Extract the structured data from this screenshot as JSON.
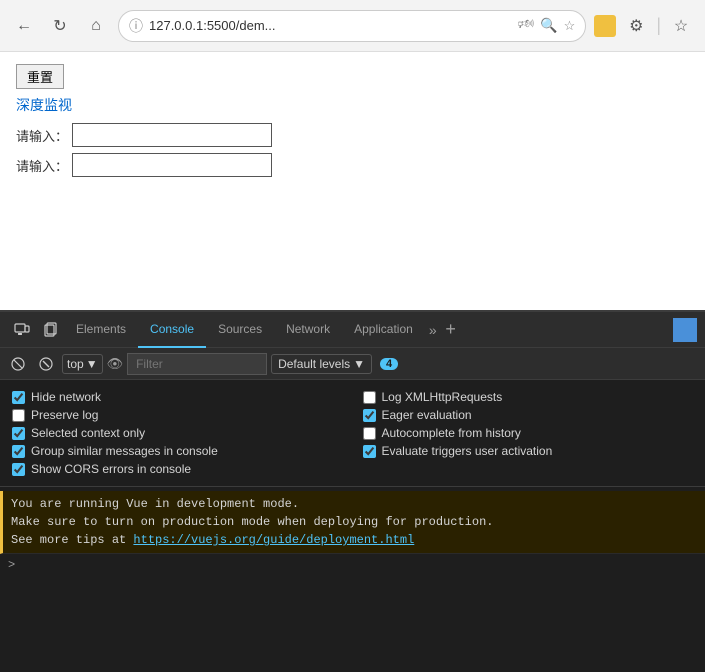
{
  "browser": {
    "url": "127.0.0.1:5500/dem...",
    "back_btn": "←",
    "reload_btn": "↻",
    "home_btn": "⌂"
  },
  "page": {
    "reset_btn_label": "重置",
    "deep_monitor_label": "深度监视",
    "input1_label": "请输入：",
    "input2_label": "请输入：",
    "input1_value": "",
    "input2_value": ""
  },
  "devtools": {
    "tabs": [
      {
        "label": "Elements",
        "active": false
      },
      {
        "label": "Console",
        "active": true
      },
      {
        "label": "Sources",
        "active": false
      },
      {
        "label": "Network",
        "active": false
      },
      {
        "label": "Application",
        "active": false
      }
    ],
    "filter_bar": {
      "top_label": "top",
      "filter_placeholder": "Filter",
      "levels_label": "Default levels",
      "badge_count": "4"
    },
    "settings": {
      "left": [
        {
          "label": "Hide network",
          "checked": true
        },
        {
          "label": "Preserve log",
          "checked": false
        },
        {
          "label": "Selected context only",
          "checked": true
        },
        {
          "label": "Group similar messages in console",
          "checked": true
        },
        {
          "label": "Show CORS errors in console",
          "checked": true
        }
      ],
      "right": [
        {
          "label": "Log XMLHttpRequests",
          "checked": false
        },
        {
          "label": "Eager evaluation",
          "checked": true
        },
        {
          "label": "Autocomplete from history",
          "checked": false
        },
        {
          "label": "Evaluate triggers user activation",
          "checked": true
        }
      ]
    },
    "console_message": {
      "line1": "You are running Vue in development mode.",
      "line2": "Make sure to turn on production mode when deploying for production.",
      "line3_prefix": "See more tips at ",
      "line3_link": "https://vuejs.org/guide/deployment.html",
      "line3_suffix": ""
    }
  }
}
